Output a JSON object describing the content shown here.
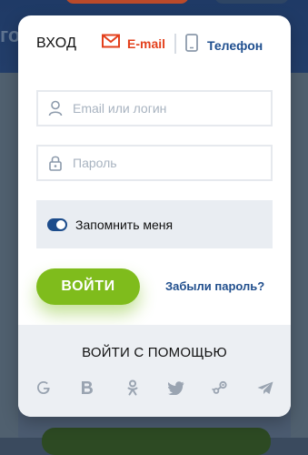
{
  "background": {
    "header_text": "гот"
  },
  "modal": {
    "title": "ВХОД",
    "tabs": {
      "email": {
        "label": "E-mail",
        "icon": "envelope-icon",
        "active": true
      },
      "phone": {
        "label": "Телефон",
        "icon": "smartphone-icon",
        "active": false
      }
    },
    "fields": {
      "login": {
        "placeholder": "Email или логин",
        "value": "",
        "icon": "user-icon"
      },
      "password": {
        "placeholder": "Пароль",
        "value": "",
        "icon": "lock-icon"
      }
    },
    "remember": {
      "label": "Запомнить меня",
      "enabled": true
    },
    "submit_label": "ВОЙТИ",
    "forgot_label": "Забыли пароль?",
    "social": {
      "title": "ВОЙТИ С ПОМОЩЬЮ",
      "providers": [
        {
          "name": "google",
          "icon": "google-icon"
        },
        {
          "name": "vk",
          "icon": "vk-icon"
        },
        {
          "name": "odnoklassniki",
          "icon": "odnoklassniki-icon"
        },
        {
          "name": "twitter",
          "icon": "twitter-icon"
        },
        {
          "name": "steam",
          "icon": "steam-icon"
        },
        {
          "name": "telegram",
          "icon": "telegram-icon"
        }
      ]
    }
  },
  "colors": {
    "accent_orange": "#e3401c",
    "accent_blue": "#1f4f8f",
    "button_green": "#7fbc1c",
    "social_icon_gray": "#9aa4b1"
  }
}
